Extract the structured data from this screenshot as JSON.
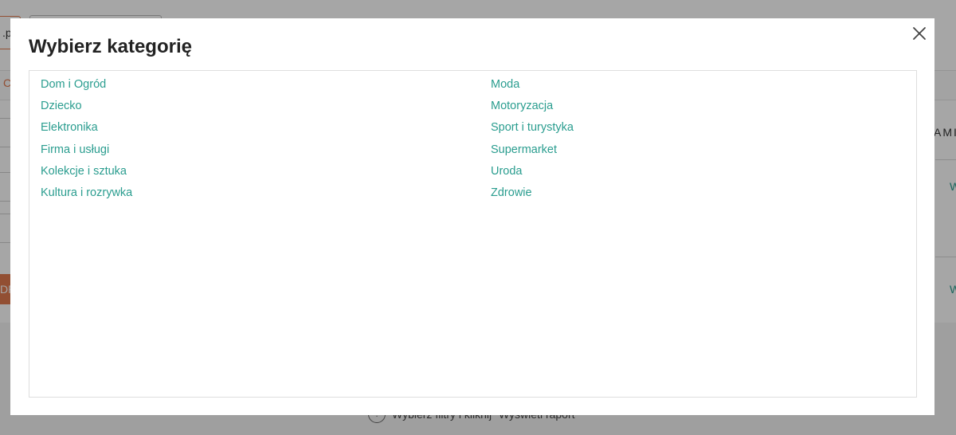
{
  "background": {
    "input_partial_text": ".pl",
    "tab_partial_text": "C",
    "column_header_partial": "AMI",
    "cell_partial_1": "W",
    "cell_partial_2": "W",
    "button_partial_text": "DR",
    "hint_icon_glyph": "!",
    "hint_text": "Wybierz filtry i kliknij \"Wyświetl raport\""
  },
  "modal": {
    "title": "Wybierz kategorię",
    "close_icon": "close-icon",
    "categories_left": [
      "Dom i Ogród",
      "Dziecko",
      "Elektronika",
      "Firma i usługi",
      "Kolekcje i sztuka",
      "Kultura i rozrywka"
    ],
    "categories_right": [
      "Moda",
      "Motoryzacja",
      "Sport i turystyka",
      "Supermarket",
      "Uroda",
      "Zdrowie"
    ]
  },
  "colors": {
    "link": "#2a9d8f",
    "accent": "#e07a4f",
    "overlay": "rgba(0,0,0,0.35)"
  }
}
